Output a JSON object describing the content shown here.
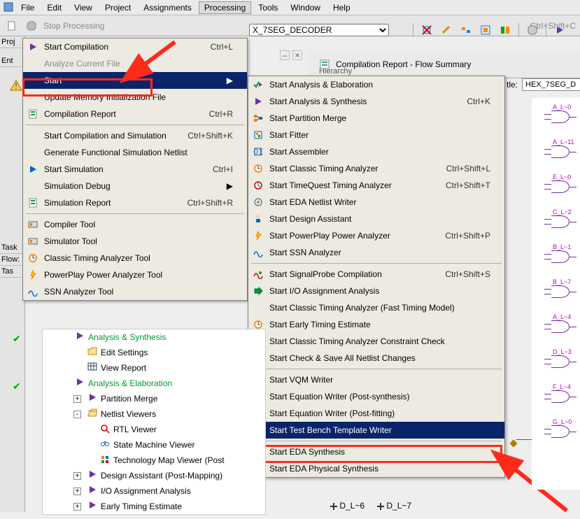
{
  "menubar": [
    "File",
    "Edit",
    "View",
    "Project",
    "Assignments",
    "Processing",
    "Tools",
    "Window",
    "Help"
  ],
  "menubar_open_index": 5,
  "toolbar": {
    "stop_label": "Stop Processing",
    "stop_shortcut": "Ctrl+Shift+C",
    "project_select_value": "X_7SEG_DECODER"
  },
  "right_header": {
    "title": "Compilation Report - Flow Summary",
    "sublabel": "Hierarchy"
  },
  "entity_input": {
    "label": "tle:",
    "value": "HEX_7SEG_D"
  },
  "left_labels": [
    "Proj",
    "Ent",
    "Task",
    "Flow:",
    "Tas"
  ],
  "processing_menu": [
    {
      "label": "Start Compilation",
      "shortcut": "Ctrl+L",
      "icon": "play"
    },
    {
      "label": "Analyze Current File",
      "dim": true,
      "icon": "none"
    },
    {
      "label": "Start",
      "selected": true,
      "submenu": true
    },
    {
      "label": "Update Memory Initialization File"
    },
    {
      "label": "Compilation Report",
      "shortcut": "Ctrl+R",
      "icon": "report"
    },
    {
      "sep": true
    },
    {
      "label": "Start Compilation and Simulation",
      "shortcut": "Ctrl+Shift+K"
    },
    {
      "label": "Generate Functional Simulation Netlist"
    },
    {
      "label": "Start Simulation",
      "shortcut": "Ctrl+I",
      "icon": "play-blue"
    },
    {
      "label": "Simulation Debug",
      "submenu": true
    },
    {
      "label": "Simulation Report",
      "shortcut": "Ctrl+Shift+R",
      "icon": "report"
    },
    {
      "sep": true
    },
    {
      "label": "Compiler Tool",
      "icon": "tool"
    },
    {
      "label": "Simulator Tool",
      "icon": "tool"
    },
    {
      "label": "Classic Timing Analyzer Tool",
      "icon": "clock"
    },
    {
      "label": "PowerPlay Power Analyzer Tool",
      "icon": "power"
    },
    {
      "label": "SSN Analyzer Tool",
      "icon": "ssn"
    }
  ],
  "start_submenu": [
    {
      "label": "Start Analysis & Elaboration",
      "icon": "check-play"
    },
    {
      "label": "Start Analysis & Synthesis",
      "shortcut": "Ctrl+K",
      "icon": "play"
    },
    {
      "label": "Start Partition Merge",
      "icon": "merge"
    },
    {
      "label": "Start Fitter",
      "icon": "fitter"
    },
    {
      "label": "Start Assembler",
      "icon": "asm"
    },
    {
      "label": "Start Classic Timing Analyzer",
      "shortcut": "Ctrl+Shift+L",
      "icon": "clock"
    },
    {
      "label": "Start TimeQuest Timing Analyzer",
      "shortcut": "Ctrl+Shift+T",
      "icon": "clock2"
    },
    {
      "label": "Start EDA Netlist Writer",
      "icon": "eda"
    },
    {
      "label": "Start Design Assistant",
      "icon": "assist"
    },
    {
      "label": "Start PowerPlay Power Analyzer",
      "shortcut": "Ctrl+Shift+P",
      "icon": "power"
    },
    {
      "label": "Start SSN Analyzer",
      "icon": "ssn"
    },
    {
      "sep": true
    },
    {
      "label": "Start SignalProbe Compilation",
      "shortcut": "Ctrl+Shift+S",
      "icon": "probe"
    },
    {
      "label": "Start I/O Assignment Analysis",
      "icon": "io"
    },
    {
      "label": "Start Classic Timing Analyzer (Fast Timing Model)"
    },
    {
      "label": "Start Early Timing Estimate",
      "icon": "clock"
    },
    {
      "label": "Start Classic Timing Analyzer Constraint Check"
    },
    {
      "label": "Start Check & Save All Netlist Changes"
    },
    {
      "sep": true
    },
    {
      "label": "Start VQM Writer"
    },
    {
      "label": "Start Equation Writer (Post-synthesis)"
    },
    {
      "label": "Start Equation Writer (Post-fitting)"
    },
    {
      "label": "Start Test Bench Template Writer",
      "selected": true
    },
    {
      "sep": true
    },
    {
      "label": "Start EDA Synthesis",
      "icon": "eda"
    },
    {
      "label": "Start EDA Physical Synthesis"
    }
  ],
  "tree": [
    {
      "indent": 1,
      "label": "Analysis & Synthesis",
      "green": true,
      "icon": "play",
      "check": true
    },
    {
      "indent": 2,
      "label": "Edit Settings",
      "icon": "folder"
    },
    {
      "indent": 2,
      "label": "View Report",
      "icon": "grid"
    },
    {
      "indent": 1,
      "label": "Analysis & Elaboration",
      "green": true,
      "icon": "play",
      "check": true
    },
    {
      "indent": 2,
      "label": "Partition Merge",
      "icon": "play",
      "expander": "+"
    },
    {
      "indent": 2,
      "label": "Netlist Viewers",
      "icon": "folder-open",
      "expander": "-"
    },
    {
      "indent": 3,
      "label": "RTL Viewer",
      "icon": "lens"
    },
    {
      "indent": 3,
      "label": "State Machine Viewer",
      "icon": "state"
    },
    {
      "indent": 3,
      "label": "Technology Map Viewer (Post",
      "icon": "map"
    },
    {
      "indent": 2,
      "label": "Design Assistant (Post-Mapping)",
      "icon": "play",
      "expander": "+"
    },
    {
      "indent": 2,
      "label": "I/O Assignment Analysis",
      "icon": "play",
      "expander": "+"
    },
    {
      "indent": 2,
      "label": "Early Timing Estimate",
      "icon": "play",
      "expander": "+"
    }
  ],
  "bottom_labels": [
    "D_L~6",
    "D_L~7"
  ],
  "schematic_labels": [
    "A_L~0",
    "A_L~11",
    "E_L~0",
    "C_L~2",
    "B_L~1",
    "B_L~7",
    "A_L~4",
    "D_L~3",
    "F_L~4",
    "G_L~0"
  ],
  "colors": {
    "select_bg": "#0a246a",
    "annotation": "#ff2a1a",
    "green": "#009933",
    "purple": "#7030a0"
  }
}
